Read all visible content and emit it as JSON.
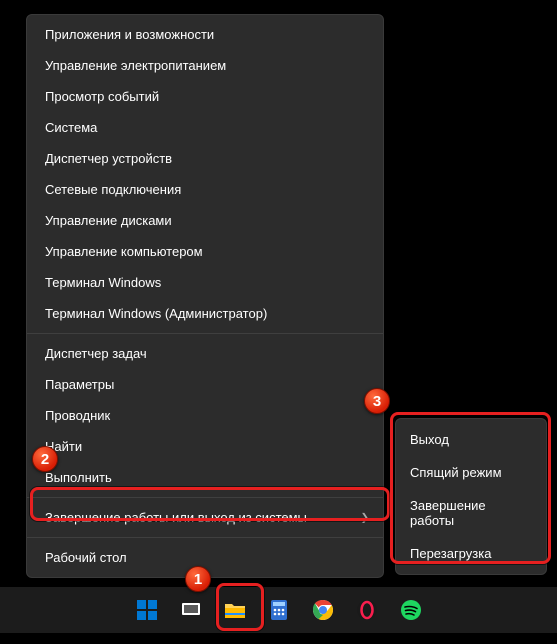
{
  "menu": {
    "group1": [
      "Приложения и возможности",
      "Управление электропитанием",
      "Просмотр событий",
      "Система",
      "Диспетчер устройств",
      "Сетевые подключения",
      "Управление дисками",
      "Управление компьютером",
      "Терминал Windows",
      "Терминал Windows (Администратор)"
    ],
    "group2": [
      "Диспетчер задач",
      "Параметры",
      "Проводник",
      "Найти",
      "Выполнить"
    ],
    "shutdown_label": "Завершение работы или выход из системы",
    "desktop_label": "Рабочий стол"
  },
  "submenu": [
    "Выход",
    "Спящий режим",
    "Завершение работы",
    "Перезагрузка"
  ],
  "badges": {
    "b1": "1",
    "b2": "2",
    "b3": "3"
  },
  "taskbar_icons": [
    "start",
    "task-view",
    "explorer",
    "calculator",
    "chrome",
    "opera-gx",
    "spotify"
  ]
}
